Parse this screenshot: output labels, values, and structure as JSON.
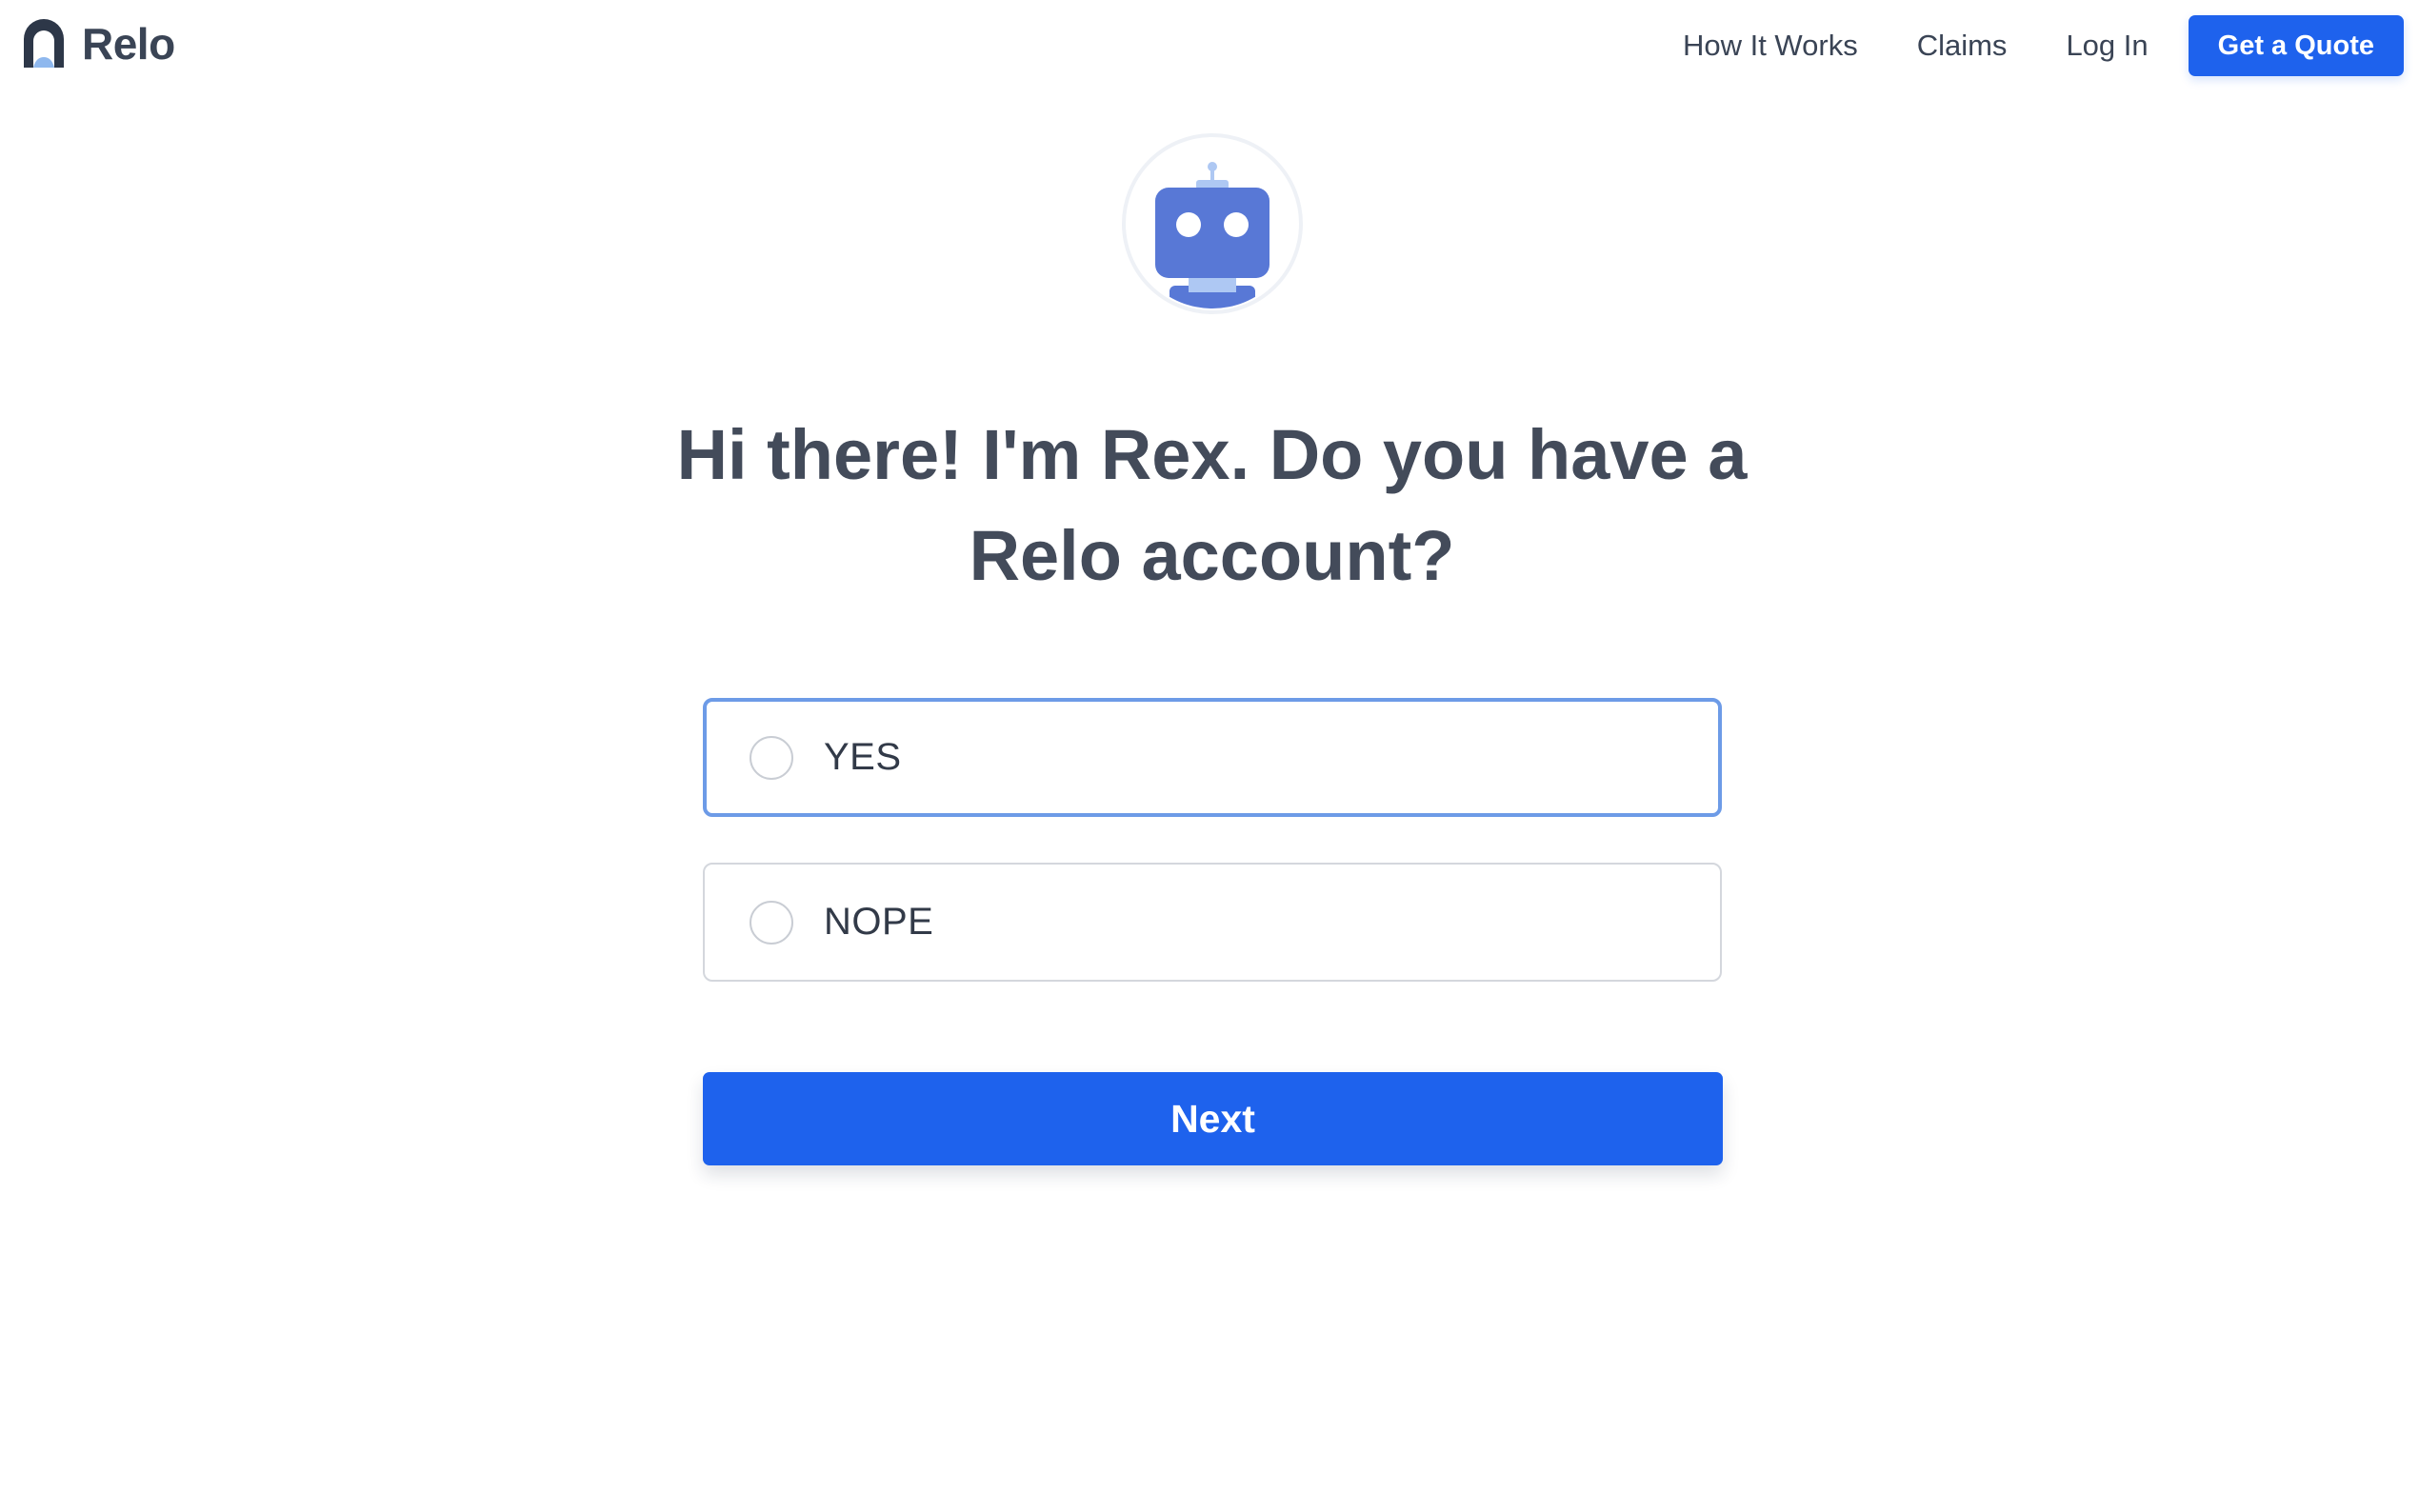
{
  "header": {
    "brand_name": "Relo",
    "nav": [
      {
        "label": "How It Works"
      },
      {
        "label": "Claims"
      },
      {
        "label": "Log In"
      }
    ],
    "cta_label": "Get a Quote"
  },
  "main": {
    "question": "Hi there! I'm Rex. Do you have a Relo account?",
    "options": [
      {
        "label": "YES",
        "selected": false
      },
      {
        "label": "NOPE",
        "selected": false
      }
    ],
    "next_label": "Next"
  },
  "colors": {
    "accent": "#1e62ed",
    "text_dark": "#3a4455",
    "robot": "#5878d6",
    "focus_border": "#6d9be7"
  },
  "icons": {
    "logo": "relo-logo-icon",
    "avatar": "robot-avatar-icon"
  }
}
